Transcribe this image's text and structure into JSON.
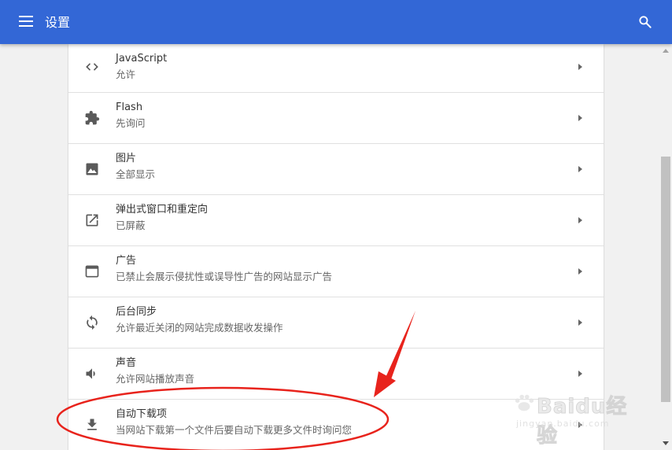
{
  "header": {
    "title": "设置",
    "menu_icon": "menu-icon",
    "search_icon": "search-icon",
    "color": "#3367d6"
  },
  "settings": [
    {
      "icon": "code-icon",
      "title": "JavaScript",
      "subtitle": "允许"
    },
    {
      "icon": "puzzle-icon",
      "title": "Flash",
      "subtitle": "先询问"
    },
    {
      "icon": "image-icon",
      "title": "图片",
      "subtitle": "全部显示"
    },
    {
      "icon": "open-in-new-icon",
      "title": "弹出式窗口和重定向",
      "subtitle": "已屏蔽"
    },
    {
      "icon": "web-asset-icon",
      "title": "广告",
      "subtitle": "已禁止会展示侵扰性或误导性广告的网站显示广告"
    },
    {
      "icon": "sync-icon",
      "title": "后台同步",
      "subtitle": "允许最近关闭的网站完成数据收发操作"
    },
    {
      "icon": "volume-icon",
      "title": "声音",
      "subtitle": "允许网站播放声音"
    },
    {
      "icon": "download-icon",
      "title": "自动下载项",
      "subtitle": "当网站下载第一个文件后要自动下载更多文件时询问您"
    }
  ],
  "annotation": {
    "color": "#e8231c"
  },
  "watermark": {
    "brand": "Baidu经验",
    "url": "jingyan.baidu.com"
  }
}
